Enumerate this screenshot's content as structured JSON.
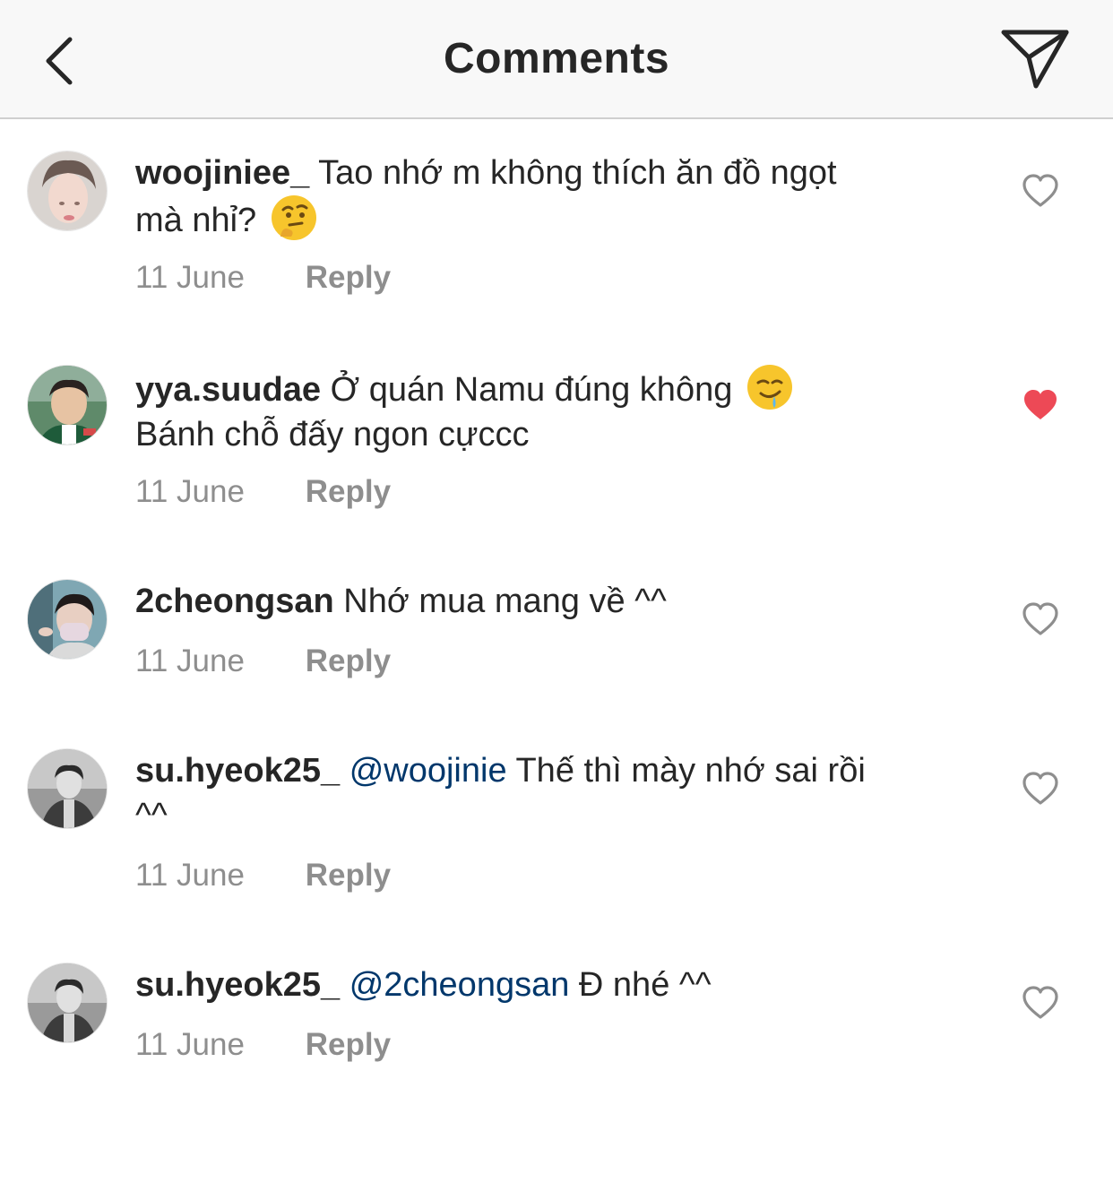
{
  "header": {
    "title": "Comments",
    "back_icon": "chevron-left-icon",
    "share_icon": "paper-plane-icon"
  },
  "comments": [
    {
      "username": "woojiniee_",
      "mention": "",
      "text": "Tao nhớ m không thích ăn đồ ngọt",
      "text2": "mà nhỉ?",
      "emoji": "thinking-face",
      "date": "11 June",
      "reply": "Reply",
      "liked": false
    },
    {
      "username": "yya.suudae",
      "mention": "",
      "text": "Ở quán Namu đúng không",
      "text2": "Bánh chỗ đấy ngon cựccc",
      "emoji": "drooling-face",
      "date": "11 June",
      "reply": "Reply",
      "liked": true
    },
    {
      "username": "2cheongsan",
      "mention": "",
      "text": "Nhớ mua mang về ^^",
      "text2": "",
      "emoji": "",
      "date": "11 June",
      "reply": "Reply",
      "liked": false
    },
    {
      "username": "su.hyeok25_",
      "mention": "@woojinie",
      "text": "Thế thì mày nhớ sai rồi",
      "text2": "^^",
      "emoji": "",
      "date": "11 June",
      "reply": "Reply",
      "liked": false
    },
    {
      "username": "su.hyeok25_",
      "mention": "@2cheongsan",
      "text": "Đ nhé ^^",
      "text2": "",
      "emoji": "",
      "date": "11 June",
      "reply": "Reply",
      "liked": false
    }
  ],
  "colors": {
    "like_active": "#ed4956",
    "mention": "#00376b",
    "meta": "#8e8e8e"
  }
}
